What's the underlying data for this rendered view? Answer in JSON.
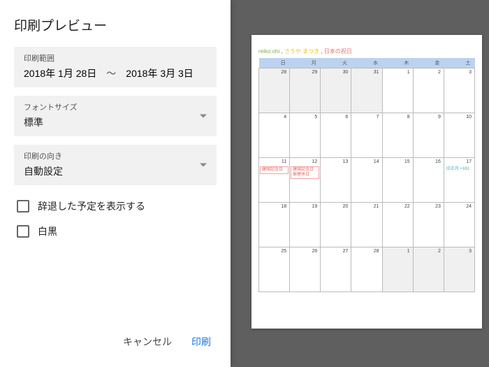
{
  "title": "印刷プレビュー",
  "range": {
    "label": "印刷範囲",
    "from": "2018年 1月 28日",
    "sep": "〜",
    "to": "2018年 3月 3日"
  },
  "fontSize": {
    "label": "フォントサイズ",
    "value": "標準"
  },
  "orientation": {
    "label": "印刷の向き",
    "value": "自動設定"
  },
  "showDeclined": {
    "label": "辞退した予定を表示する"
  },
  "blackWhite": {
    "label": "白黒"
  },
  "buttons": {
    "cancel": "キャンセル",
    "print": "印刷"
  },
  "legend": {
    "a": "reiko.ohi",
    "b": "さうや まつき",
    "c": ", ",
    "d": "日本の祝日"
  },
  "weekdays": [
    "日",
    "月",
    "火",
    "水",
    "木",
    "金",
    "土"
  ],
  "weeks": [
    [
      {
        "n": "28",
        "dim": true
      },
      {
        "n": "29",
        "dim": true
      },
      {
        "n": "30",
        "dim": true
      },
      {
        "n": "31",
        "dim": true
      },
      {
        "n": "1"
      },
      {
        "n": "2"
      },
      {
        "n": "3"
      }
    ],
    [
      {
        "n": "4"
      },
      {
        "n": "5"
      },
      {
        "n": "6"
      },
      {
        "n": "7"
      },
      {
        "n": "8"
      },
      {
        "n": "9"
      },
      {
        "n": "10"
      }
    ],
    [
      {
        "n": "11",
        "ev": [
          {
            "t": "建国記念日",
            "c": "red"
          }
        ]
      },
      {
        "n": "12",
        "ev": [
          {
            "t": "建国記念日 振替休日",
            "c": "red"
          }
        ]
      },
      {
        "n": "13"
      },
      {
        "n": "14"
      },
      {
        "n": "15"
      },
      {
        "n": "16"
      },
      {
        "n": "17",
        "ev": [
          {
            "t": "旧正月 • 691",
            "c": "teal"
          }
        ]
      }
    ],
    [
      {
        "n": "18"
      },
      {
        "n": "19"
      },
      {
        "n": "20"
      },
      {
        "n": "21"
      },
      {
        "n": "22"
      },
      {
        "n": "23"
      },
      {
        "n": "24"
      }
    ],
    [
      {
        "n": "25"
      },
      {
        "n": "26"
      },
      {
        "n": "27"
      },
      {
        "n": "28"
      },
      {
        "n": "1",
        "dim": true
      },
      {
        "n": "2",
        "dim": true
      },
      {
        "n": "3",
        "dim": true
      }
    ]
  ]
}
